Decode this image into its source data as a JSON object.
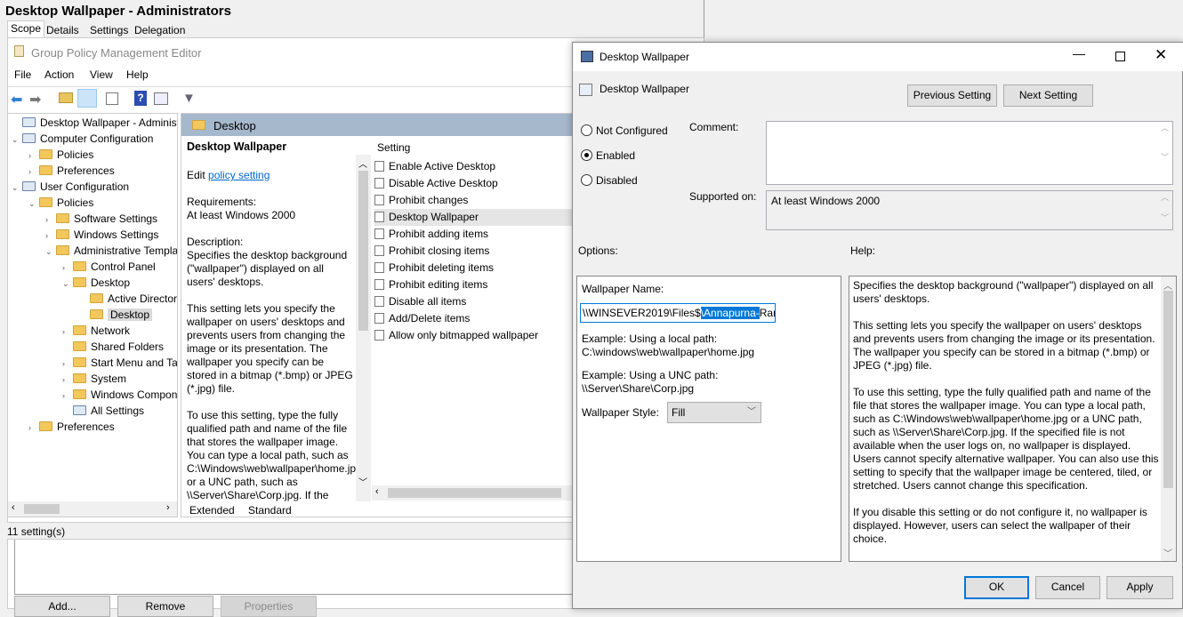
{
  "window": {
    "title": "Desktop Wallpaper - Administrators",
    "tabs": [
      "Scope",
      "Details",
      "Settings",
      "Delegation"
    ]
  },
  "editor": {
    "title": "Group Policy Management Editor",
    "menu": [
      "File",
      "Action",
      "View",
      "Help"
    ],
    "toolbar": [
      "back-icon",
      "forward-icon",
      "up-folder-icon",
      "show-hide-tree-icon",
      "export-icon",
      "help-icon",
      "properties-pane-icon",
      "filter-icon"
    ]
  },
  "tree": [
    {
      "label": "Desktop Wallpaper - Administrators",
      "level": 0,
      "icon": "gpo-icon",
      "chev": ""
    },
    {
      "label": "Computer Configuration",
      "level": 0,
      "icon": "computer-icon",
      "chev": "v"
    },
    {
      "label": "Policies",
      "level": 1,
      "icon": "folder-icon",
      "chev": ">"
    },
    {
      "label": "Preferences",
      "level": 1,
      "icon": "folder-icon",
      "chev": ">"
    },
    {
      "label": "User Configuration",
      "level": 0,
      "icon": "user-icon",
      "chev": "v"
    },
    {
      "label": "Policies",
      "level": 1,
      "icon": "folder-icon",
      "chev": "v"
    },
    {
      "label": "Software Settings",
      "level": 2,
      "icon": "folder-icon",
      "chev": ">"
    },
    {
      "label": "Windows Settings",
      "level": 2,
      "icon": "folder-icon",
      "chev": ">"
    },
    {
      "label": "Administrative Templates",
      "level": 2,
      "icon": "folder-icon",
      "chev": "v"
    },
    {
      "label": "Control Panel",
      "level": 3,
      "icon": "folder-icon",
      "chev": ">"
    },
    {
      "label": "Desktop",
      "level": 3,
      "icon": "folder-icon",
      "chev": "v"
    },
    {
      "label": "Active Directory",
      "level": 4,
      "icon": "folder-icon",
      "chev": ""
    },
    {
      "label": "Desktop",
      "level": 4,
      "icon": "folder-icon",
      "chev": "",
      "selected": true
    },
    {
      "label": "Network",
      "level": 3,
      "icon": "folder-icon",
      "chev": ">"
    },
    {
      "label": "Shared Folders",
      "level": 3,
      "icon": "folder-icon",
      "chev": ""
    },
    {
      "label": "Start Menu and Taskbar",
      "level": 3,
      "icon": "folder-icon",
      "chev": ">"
    },
    {
      "label": "System",
      "level": 3,
      "icon": "folder-icon",
      "chev": ">"
    },
    {
      "label": "Windows Components",
      "level": 3,
      "icon": "folder-icon",
      "chev": ">"
    },
    {
      "label": "All Settings",
      "level": 3,
      "icon": "all-settings-icon",
      "chev": ""
    },
    {
      "label": "Preferences",
      "level": 1,
      "icon": "folder-icon",
      "chev": ">"
    }
  ],
  "middle": {
    "header": "Desktop",
    "desc_title": "Desktop Wallpaper",
    "edit_prefix": "Edit ",
    "edit_link": "policy setting",
    "req_label": "Requirements:",
    "req_value": "At least Windows 2000",
    "desc_label": "Description:",
    "desc_p1": "Specifies the desktop background (\"wallpaper\") displayed on all users' desktops.",
    "desc_p2": "This setting lets you specify the wallpaper on users' desktops and prevents users from changing the image or its presentation. The wallpaper you specify can be stored in a bitmap (*.bmp) or JPEG (*.jpg) file.",
    "desc_p3": "To use this setting, type the fully qualified path and name of the file that stores the wallpaper image. You can type a local path, such as C:\\Windows\\web\\wallpaper\\home.jpg or a UNC path, such as \\\\Server\\Share\\Corp.jpg. If the",
    "setting_header": "Setting",
    "settings": [
      "Enable Active Desktop",
      "Disable Active Desktop",
      "Prohibit changes",
      "Desktop Wallpaper",
      "Prohibit adding items",
      "Prohibit closing items",
      "Prohibit deleting items",
      "Prohibit editing items",
      "Disable all items",
      "Add/Delete items",
      "Allow only bitmapped wallpaper"
    ],
    "selected_setting": "Desktop Wallpaper",
    "view_tabs": [
      "Extended",
      "Standard"
    ]
  },
  "status": "11 setting(s)",
  "bottom_buttons": {
    "add": "Add...",
    "remove": "Remove",
    "properties": "Properties"
  },
  "dialog": {
    "title": "Desktop Wallpaper",
    "setting_name": "Desktop Wallpaper",
    "prev": "Previous Setting",
    "next": "Next Setting",
    "radios": [
      {
        "label": "Not Configured",
        "checked": false
      },
      {
        "label": "Enabled",
        "checked": true
      },
      {
        "label": "Disabled",
        "checked": false
      }
    ],
    "comment_label": "Comment:",
    "comment_value": "",
    "supported_label": "Supported on:",
    "supported_value": "At least Windows 2000",
    "options_label": "Options:",
    "help_label": "Help:",
    "wallpaper_name_label": "Wallpaper Name:",
    "wallpaper_name_pre": "\\\\WINSEVER2019\\Files$",
    "wallpaper_name_sel": "\\Annapurna-",
    "wallpaper_name_post": "Rang",
    "ex1_label": "Example: Using a local path:",
    "ex1_value": "C:\\windows\\web\\wallpaper\\home.jpg",
    "ex2_label": "Example: Using a UNC path:",
    "ex2_value": "\\\\Server\\Share\\Corp.jpg",
    "style_label": "Wallpaper Style:",
    "style_value": "Fill",
    "help": [
      "Specifies the desktop background (\"wallpaper\") displayed on all users' desktops.",
      "This setting lets you specify the wallpaper on users' desktops and prevents users from changing the image or its presentation. The wallpaper you specify can be stored in a bitmap (*.bmp) or JPEG (*.jpg) file.",
      "To use this setting, type the fully qualified path and name of the file that stores the wallpaper image. You can type a local path, such as C:\\Windows\\web\\wallpaper\\home.jpg or a UNC path, such as \\\\Server\\Share\\Corp.jpg. If the specified file is not available when the user logs on, no wallpaper is displayed. Users cannot specify alternative wallpaper. You can also use this setting to specify that the wallpaper image be centered, tiled, or stretched. Users cannot change this specification.",
      "If you disable this setting or do not configure it, no wallpaper is displayed. However, users can select the wallpaper of their choice."
    ],
    "ok": "OK",
    "cancel": "Cancel",
    "apply": "Apply"
  },
  "colors": {
    "accent": "#0078d7",
    "header_band": "#a6b8cc",
    "selection": "#cce8ff",
    "link": "#0066cc"
  }
}
